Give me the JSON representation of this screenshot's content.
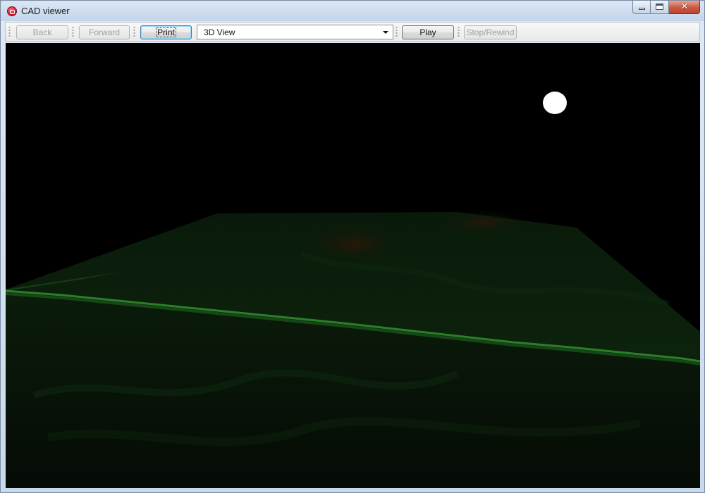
{
  "window": {
    "title": "CAD viewer",
    "caption": {
      "minimize_icon": "minimize-icon",
      "maximize_icon": "maximize-icon",
      "close_icon": "close-icon",
      "close_glyph": "✕"
    }
  },
  "toolbar": {
    "back_label": "Back",
    "back_enabled": false,
    "forward_label": "Forward",
    "forward_enabled": false,
    "print_label": "Print",
    "print_enabled": true,
    "view_select": {
      "selected": "3D View"
    },
    "play_label": "Play",
    "play_enabled": true,
    "stop_rewind_label": "Stop/Rewind",
    "stop_rewind_enabled": false
  },
  "viewport": {
    "scene": "3d-terrain-view",
    "background_color": "#000000",
    "terrain_color": "#0b1f0b",
    "ridge_color": "#2a7a2a",
    "light_color": "#ffffff"
  }
}
